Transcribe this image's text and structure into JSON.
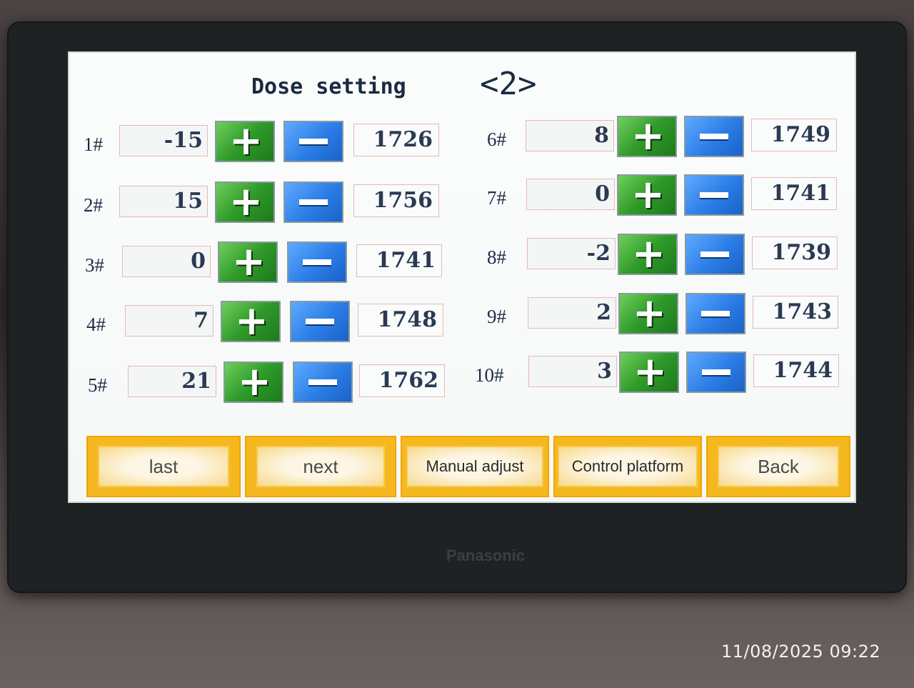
{
  "device": {
    "brand": "Panasonic"
  },
  "screen": {
    "title": "Dose setting",
    "page_indicator": "<2>",
    "left_rows": [
      {
        "label": "1#",
        "offset": "-15",
        "value": "1726"
      },
      {
        "label": "2#",
        "offset": "15",
        "value": "1756"
      },
      {
        "label": "3#",
        "offset": "0",
        "value": "1741"
      },
      {
        "label": "4#",
        "offset": "7",
        "value": "1748"
      },
      {
        "label": "5#",
        "offset": "21",
        "value": "1762"
      }
    ],
    "right_rows": [
      {
        "label": "6#",
        "offset": "8",
        "value": "1749"
      },
      {
        "label": "7#",
        "offset": "0",
        "value": "1741"
      },
      {
        "label": "8#",
        "offset": "-2",
        "value": "1739"
      },
      {
        "label": "9#",
        "offset": "2",
        "value": "1743"
      },
      {
        "label": "10#",
        "offset": "3",
        "value": "1744"
      }
    ],
    "nav": {
      "last": "last",
      "next": "next",
      "manual_adjust": "Manual adjust",
      "control_platform": "Control platform",
      "back": "Back"
    },
    "colors": {
      "plus_button": "#2f9a2a",
      "minus_button": "#2b7de6",
      "nav_button": "#f5b81f"
    }
  },
  "photo_timestamp": "11/08/2025 09:22"
}
